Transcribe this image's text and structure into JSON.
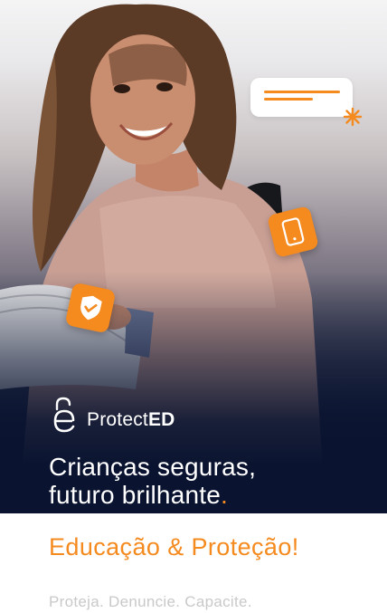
{
  "brand": {
    "name_prefix": "Protect",
    "name_suffix": "ED",
    "icon": "lock-e-logo-icon"
  },
  "hero": {
    "headline_line1": "Crianças seguras,",
    "headline_line2": "futuro brilhante",
    "headline_dot": ".",
    "icons": [
      "chat-bubble-icon",
      "sparkle-icon",
      "phone-icon",
      "shield-check-icon"
    ]
  },
  "tagline": "Educação & Proteção!",
  "subline": "Proteja. Denuncie. Capacite.",
  "colors": {
    "accent": "#f58a1f",
    "navy": "#0a1430",
    "muted_text": "#c9c9cc",
    "white": "#ffffff"
  }
}
